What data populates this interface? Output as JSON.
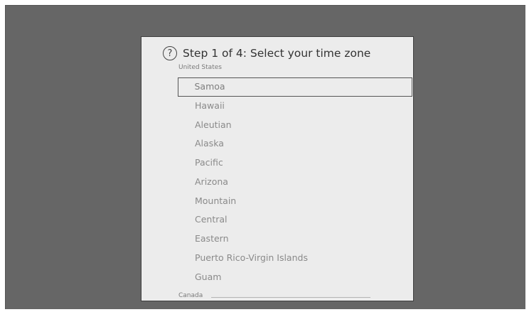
{
  "dialog": {
    "title": "Step 1 of 4: Select your time zone",
    "help_icon_glyph": "?",
    "help_icon_name": "help-circle-icon"
  },
  "section": {
    "label": "United States"
  },
  "zones": [
    "Samoa",
    "Hawaii",
    "Aleutian",
    "Alaska",
    "Pacific",
    "Arizona",
    "Mountain",
    "Central",
    "Eastern",
    "Puerto Rico-Virgin Islands",
    "Guam"
  ],
  "selected_zone": "Samoa",
  "next_section": {
    "label": "Canada"
  },
  "colors": {
    "screen_background": "#666666",
    "dialog_background": "#ececec",
    "title_text": "#333333",
    "item_text": "#8a8a8a",
    "selection_border": "#555555"
  }
}
